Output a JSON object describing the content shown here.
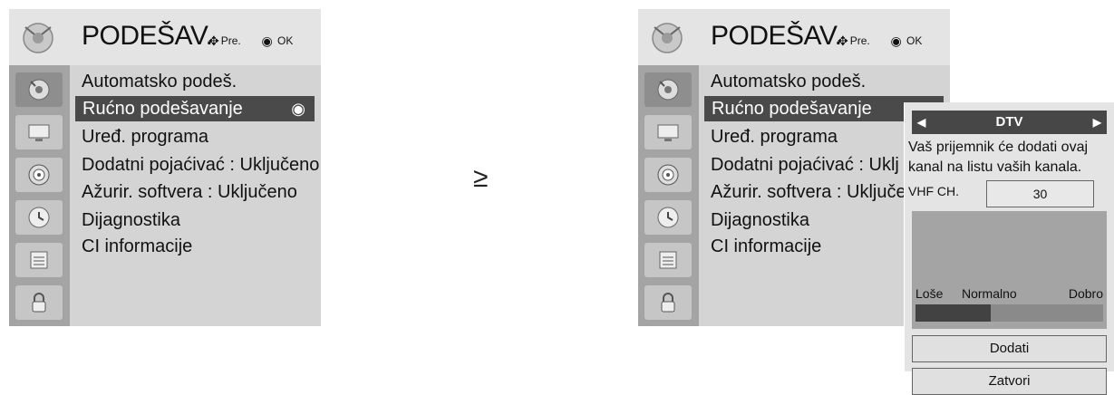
{
  "menu": {
    "title": "PODEŠAV.",
    "hint_move": "Pre.",
    "hint_ok": "OK",
    "items": [
      "Automatsko podeš.",
      "Rućno podešavanje",
      "Uređ. programa",
      "Dodatni pojaćivać   : Uključeno",
      "Ažurir. softvera : Uključeno",
      "Dijagnostika",
      "CI informacije"
    ],
    "items_right": [
      "Automatsko podeš.",
      "Rućno podešavanje",
      "Uređ. programa",
      "Dodatni pojaćivać   : Uklj",
      "Ažurir. softvera : Uključen",
      "Dijagnostika",
      "CI informacije"
    ],
    "selected_index": 1
  },
  "arrow": "≥",
  "popup": {
    "title": "DTV",
    "message": "Vaš prijemnik će dodati ovaj kanal na listu vaših kanala.",
    "vhf_label": "VHF CH.",
    "vhf_value": "30",
    "signal": {
      "low": "Loše",
      "mid": "Normalno",
      "high": "Dobro",
      "level": 0.4
    },
    "add_button": "Dodati",
    "close_button": "Zatvori"
  },
  "colors": {
    "header_bg": "#e4e4e4",
    "side_bg": "#a4a4a4",
    "main_bg": "#d4d4d4",
    "selected_bg": "#4a4a4a"
  },
  "icons": [
    "satellite-icon",
    "monitor-icon",
    "speaker-icon",
    "clock-icon",
    "options-icon",
    "lock-icon"
  ]
}
